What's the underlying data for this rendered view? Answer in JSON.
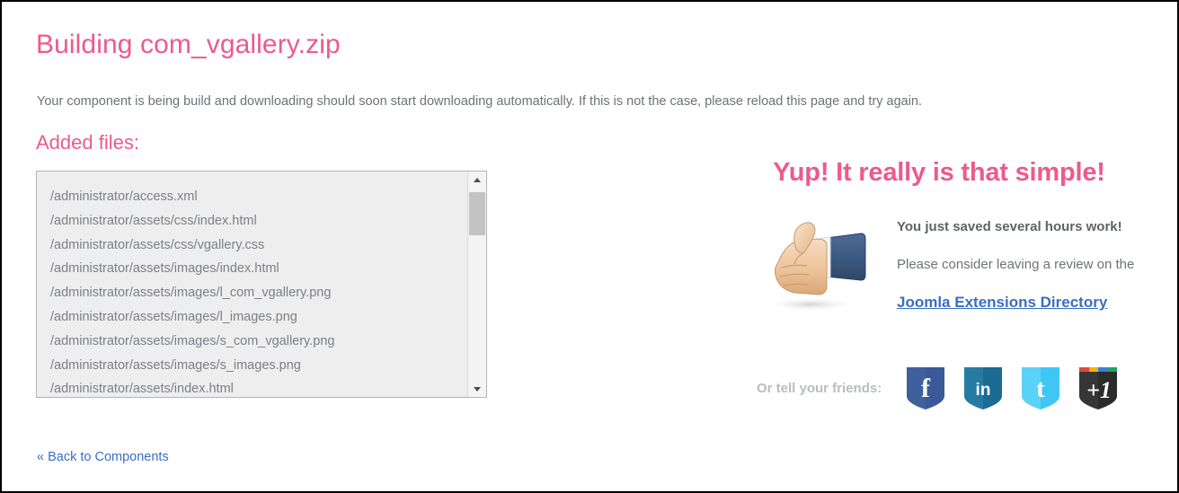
{
  "page": {
    "title": "Building com_vgallery.zip",
    "intro": "Your component is being build and downloading should soon start downloading automatically. If this is not the case, please reload this page and try again.",
    "subtitle": "Added files:",
    "back_link": "« Back to Components",
    "accent_color": "#ED5A8B",
    "link_color": "#3a6ec2"
  },
  "filelist": {
    "files": [
      "/administrator/access.xml",
      "/administrator/assets/css/index.html",
      "/administrator/assets/css/vgallery.css",
      "/administrator/assets/images/index.html",
      "/administrator/assets/images/l_com_vgallery.png",
      "/administrator/assets/images/l_images.png",
      "/administrator/assets/images/s_com_vgallery.png",
      "/administrator/assets/images/s_images.png",
      "/administrator/assets/index.html"
    ],
    "scrollbar": {
      "up_arrow": "chevron-up-icon",
      "down_arrow": "chevron-down-icon"
    }
  },
  "promo": {
    "headline": "Yup! It really is that simple!",
    "image": "thumbs-up-icon",
    "line1": "You just saved several hours work!",
    "line2": "Please consider leaving a review on the",
    "jed_link": "Joomla Extensions Directory",
    "share_label": "Or tell your friends:",
    "share_icons": [
      {
        "name": "facebook-share-icon",
        "glyph": "f",
        "color": "#3b5998"
      },
      {
        "name": "linkedin-share-icon",
        "glyph": "in",
        "color": "#1b6b93"
      },
      {
        "name": "twitter-share-icon",
        "glyph": "t",
        "color": "#3fc7f4"
      },
      {
        "name": "googleplus-one-share-icon",
        "glyph": "+1",
        "color": "#2b2b2b"
      }
    ]
  }
}
